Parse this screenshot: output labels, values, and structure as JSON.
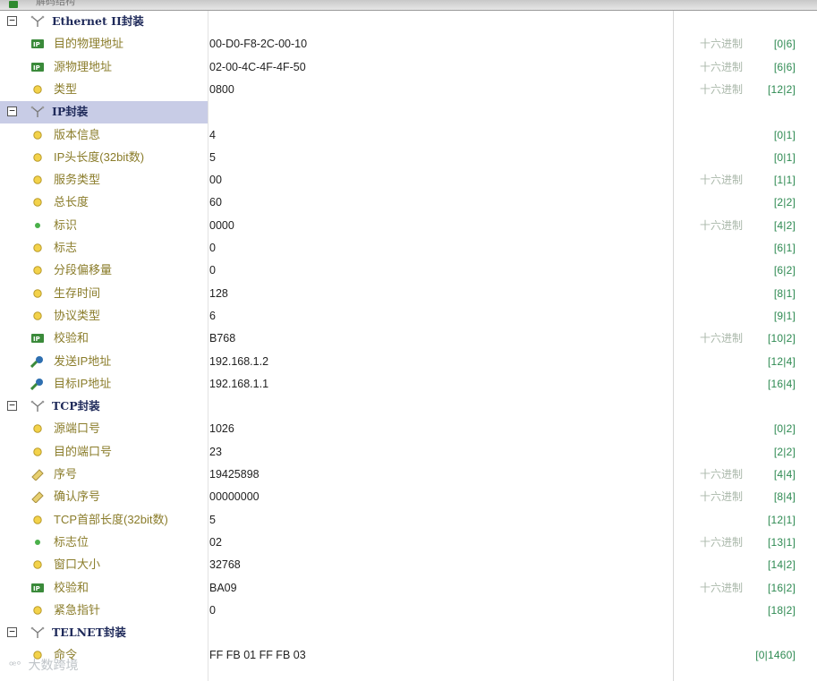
{
  "topbar": {
    "label": "解码结构"
  },
  "colors": {
    "field_name": "#8a7c2a",
    "section_name": "#1f2a5a",
    "hex_hint": "#a9b7a9",
    "position": "#2e8a52",
    "highlight": "#c8cce6"
  },
  "rows": [
    {
      "kind": "section",
      "expander": "−",
      "icon": "protocol-icon",
      "name": "Ethernet II封装",
      "value": "",
      "fmt": "",
      "pos": ""
    },
    {
      "kind": "field",
      "icon": "ip-chip-icon",
      "name": "目的物理地址",
      "value": "00-D0-F8-2C-00-10",
      "fmt": "十六进制",
      "pos": "[0|6]"
    },
    {
      "kind": "field",
      "icon": "ip-chip-icon",
      "name": "源物理地址",
      "value": "02-00-4C-4F-4F-50",
      "fmt": "十六进制",
      "pos": "[6|6]"
    },
    {
      "kind": "field",
      "icon": "field-dot-icon",
      "name": "类型",
      "value": "0800",
      "fmt": "十六进制",
      "pos": "[12|2]"
    },
    {
      "kind": "section",
      "expander": "−",
      "icon": "protocol-icon",
      "name": "IP封装",
      "value": "",
      "fmt": "",
      "pos": "",
      "highlight": true
    },
    {
      "kind": "field",
      "icon": "field-dot-icon",
      "name": "版本信息",
      "value": "4",
      "fmt": "",
      "pos": "[0|1]"
    },
    {
      "kind": "field",
      "icon": "field-dot-icon",
      "name": "IP头长度(32bit数)",
      "value": "5",
      "fmt": "",
      "pos": "[0|1]"
    },
    {
      "kind": "field",
      "icon": "field-dot-icon",
      "name": "服务类型",
      "value": "00",
      "fmt": "十六进制",
      "pos": "[1|1]"
    },
    {
      "kind": "field",
      "icon": "field-dot-icon",
      "name": "总长度",
      "value": "60",
      "fmt": "",
      "pos": "[2|2]"
    },
    {
      "kind": "field",
      "icon": "green-dot-icon",
      "name": "标识",
      "value": "0000",
      "fmt": "十六进制",
      "pos": "[4|2]"
    },
    {
      "kind": "field",
      "icon": "field-dot-icon",
      "name": "标志",
      "value": "0",
      "fmt": "",
      "pos": "[6|1]"
    },
    {
      "kind": "field",
      "icon": "field-dot-icon",
      "name": "分段偏移量",
      "value": "0",
      "fmt": "",
      "pos": "[6|2]"
    },
    {
      "kind": "field",
      "icon": "field-dot-icon",
      "name": "生存时间",
      "value": "128",
      "fmt": "",
      "pos": "[8|1]"
    },
    {
      "kind": "field",
      "icon": "field-dot-icon",
      "name": "协议类型",
      "value": "6",
      "fmt": "",
      "pos": "[9|1]"
    },
    {
      "kind": "field",
      "icon": "ip-chip-icon",
      "name": "校验和",
      "value": "B768",
      "fmt": "十六进制",
      "pos": "[10|2]"
    },
    {
      "kind": "field",
      "icon": "host-icon",
      "name": "发送IP地址",
      "value": "192.168.1.2",
      "fmt": "",
      "pos": "[12|4]"
    },
    {
      "kind": "field",
      "icon": "host-icon",
      "name": "目标IP地址",
      "value": "192.168.1.1",
      "fmt": "",
      "pos": "[16|4]"
    },
    {
      "kind": "section",
      "expander": "−",
      "icon": "protocol-icon",
      "name": "TCP封装",
      "value": "",
      "fmt": "",
      "pos": ""
    },
    {
      "kind": "field",
      "icon": "field-dot-icon",
      "name": "源端口号",
      "value": "1026",
      "fmt": "",
      "pos": "[0|2]"
    },
    {
      "kind": "field",
      "icon": "field-dot-icon",
      "name": "目的端口号",
      "value": "23",
      "fmt": "",
      "pos": "[2|2]"
    },
    {
      "kind": "field",
      "icon": "sequence-icon",
      "name": "序号",
      "value": "19425898",
      "fmt": "十六进制",
      "pos": "[4|4]"
    },
    {
      "kind": "field",
      "icon": "sequence-icon",
      "name": "确认序号",
      "value": "00000000",
      "fmt": "十六进制",
      "pos": "[8|4]"
    },
    {
      "kind": "field",
      "icon": "field-dot-icon",
      "name": "TCP首部长度(32bit数)",
      "value": "5",
      "fmt": "",
      "pos": "[12|1]"
    },
    {
      "kind": "field",
      "icon": "green-dot-icon",
      "name": "标志位",
      "value": "02",
      "fmt": "十六进制",
      "pos": "[13|1]"
    },
    {
      "kind": "field",
      "icon": "field-dot-icon",
      "name": "窗口大小",
      "value": "32768",
      "fmt": "",
      "pos": "[14|2]"
    },
    {
      "kind": "field",
      "icon": "ip-chip-icon",
      "name": "校验和",
      "value": "BA09",
      "fmt": "十六进制",
      "pos": "[16|2]"
    },
    {
      "kind": "field",
      "icon": "field-dot-icon",
      "name": "紧急指针",
      "value": "0",
      "fmt": "",
      "pos": "[18|2]"
    },
    {
      "kind": "section",
      "expander": "−",
      "icon": "protocol-icon",
      "name": "TELNET封装",
      "value": "",
      "fmt": "",
      "pos": ""
    },
    {
      "kind": "field",
      "icon": "field-dot-icon",
      "name": "命令",
      "value": "FF FB 01 FF FB 03",
      "fmt": "",
      "pos": "[0|1460]"
    }
  ],
  "watermark": {
    "text": "大数跨境"
  }
}
